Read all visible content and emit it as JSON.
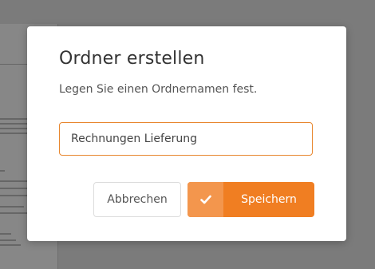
{
  "dialog": {
    "title": "Ordner erstellen",
    "subtitle": "Legen Sie einen Ordnernamen fest.",
    "folder_name_value": "Rechnungen Lieferung",
    "cancel_label": "Abbrechen",
    "save_label": "Speichern"
  },
  "colors": {
    "accent": "#f07e22",
    "accent_light": "#f3964d",
    "backdrop": "#7b7b7b"
  },
  "icons": {
    "save": "checkmark-icon"
  }
}
